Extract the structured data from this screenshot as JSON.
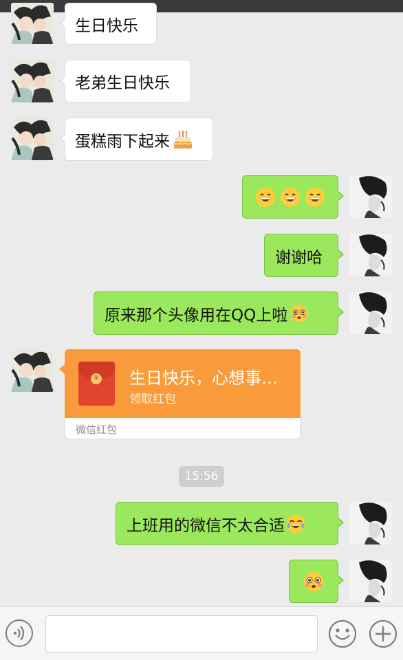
{
  "messages": {
    "m1": "生日快乐",
    "m2": "老弟生日快乐",
    "m3": "蛋糕雨下起来",
    "m5": "谢谢哈",
    "m6": "原来那个头像用在QQ上啦",
    "m9": "上班用的微信不太合适"
  },
  "red_packet": {
    "title": "生日快乐，心想事…",
    "subtitle": "领取红包",
    "footer": "微信红包",
    "coin": "￥"
  },
  "timestamp": "15:56",
  "input": {
    "value": ""
  },
  "icons": {
    "m3_emoji": "birthday-cake-icon",
    "m4_emoji": "grinning-face-icon",
    "m6_emoji": "flushed-face-icon",
    "m9_emoji": "tears-of-joy-icon",
    "m10_emoji": "flushed-face-icon",
    "voice": "voice-icon",
    "emoji_button": "smiley-icon",
    "plus": "plus-icon"
  },
  "colors": {
    "background": "#ebebeb",
    "sent_bubble": "#9ce85c",
    "received_bubble": "#ffffff",
    "red_packet": "#f99a3b"
  }
}
